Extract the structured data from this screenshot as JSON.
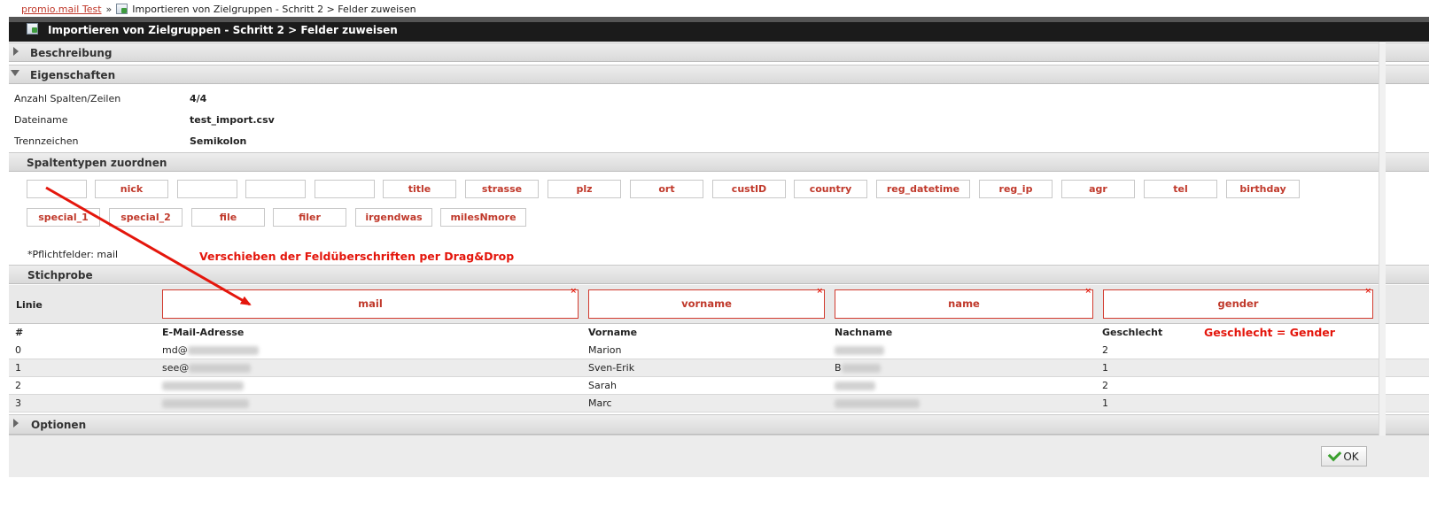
{
  "breadcrumb": {
    "home": "promio.mail Test",
    "sep": "»",
    "page": "Importieren von Zielgruppen - Schritt 2 > Felder zuweisen"
  },
  "title": "Importieren von Zielgruppen - Schritt 2 > Felder zuweisen",
  "sections": {
    "beschreibung": "Beschreibung",
    "eigenschaften": "Eigenschaften",
    "spaltentypen": "Spaltentypen zuordnen",
    "stichprobe": "Stichprobe",
    "optionen": "Optionen"
  },
  "properties": [
    {
      "label": "Anzahl Spalten/Zeilen",
      "value": "4/4"
    },
    {
      "label": "Dateiname",
      "value": "test_import.csv"
    },
    {
      "label": "Trennzeichen",
      "value": "Semikolon"
    }
  ],
  "chips_row1": [
    "",
    "nick",
    "",
    "",
    "",
    "title",
    "strasse",
    "plz",
    "ort",
    "custID",
    "country",
    "reg_datetime",
    "reg_ip",
    "agr",
    "tel",
    "birthday"
  ],
  "chips_row2": [
    "special_1",
    "special_2",
    "file",
    "filer",
    "irgendwas",
    "milesNmore"
  ],
  "required_note": "*Pflichtfelder: mail",
  "annotations": {
    "drag": "Verschieben der Feldüberschriften per Drag&Drop",
    "gender": "Geschlecht = Gender"
  },
  "linie_label": "Linie",
  "mapped": [
    "mail",
    "vorname",
    "name",
    "gender"
  ],
  "remove_glyph": "×",
  "table": {
    "headers": [
      "#",
      "E-Mail-Adresse",
      "Vorname",
      "Nachname",
      "Geschlecht"
    ],
    "rows": [
      {
        "n": "0",
        "email": "md@",
        "vorname": "Marion",
        "nachname": "",
        "g": "2"
      },
      {
        "n": "1",
        "email": "see@",
        "vorname": "Sven-Erik",
        "nachname": "B",
        "g": "1"
      },
      {
        "n": "2",
        "email": "",
        "vorname": "Sarah",
        "nachname": "",
        "g": "2"
      },
      {
        "n": "3",
        "email": "",
        "vorname": "Marc",
        "nachname": "",
        "g": "1"
      }
    ]
  },
  "ok_label": "OK",
  "colors": {
    "accent_red": "#c0392b",
    "annotation_red": "#e4160c",
    "titlebar": "#1b1b1b"
  }
}
